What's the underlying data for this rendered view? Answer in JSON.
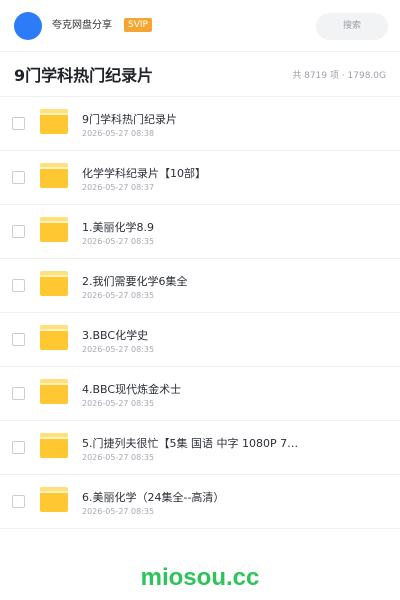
{
  "header": {
    "site_name": "夸克网盘分享",
    "badge": "SVIP",
    "search_label": "搜索",
    "avatar_color": "#2b7cf6"
  },
  "page": {
    "title": "9门学科热门纪录片",
    "stats": "共 8719 项 · 1798.0G"
  },
  "items": [
    {
      "name": "9门学科热门纪录片",
      "date": "2026-05-27 08:38",
      "icon": "folder-icon"
    },
    {
      "name": "化学学科纪录片【10部】",
      "date": "2026-05-27 08:37",
      "icon": "folder-icon"
    },
    {
      "name": "1.美丽化学8.9",
      "date": "2026-05-27 08:35",
      "icon": "folder-icon"
    },
    {
      "name": "2.我们需要化学6集全",
      "date": "2026-05-27 08:35",
      "icon": "folder-icon"
    },
    {
      "name": "3.BBC化学史",
      "date": "2026-05-27 08:35",
      "icon": "folder-icon"
    },
    {
      "name": "4.BBC现代炼金术士",
      "date": "2026-05-27 08:35",
      "icon": "folder-icon"
    },
    {
      "name": "5.门捷列夫很忙【5集 国语 中字 1080P 7…",
      "date": "2026-05-27 08:35",
      "icon": "folder-icon"
    },
    {
      "name": "6.美丽化学（24集全--高清）",
      "date": "2026-05-27 08:35",
      "icon": "folder-icon"
    }
  ],
  "watermark": "miosou.cc",
  "colors": {
    "accent": "#2b7cf6",
    "badge": "#f5a531",
    "folder": "#ffc832",
    "watermark": "#2fc35b"
  }
}
